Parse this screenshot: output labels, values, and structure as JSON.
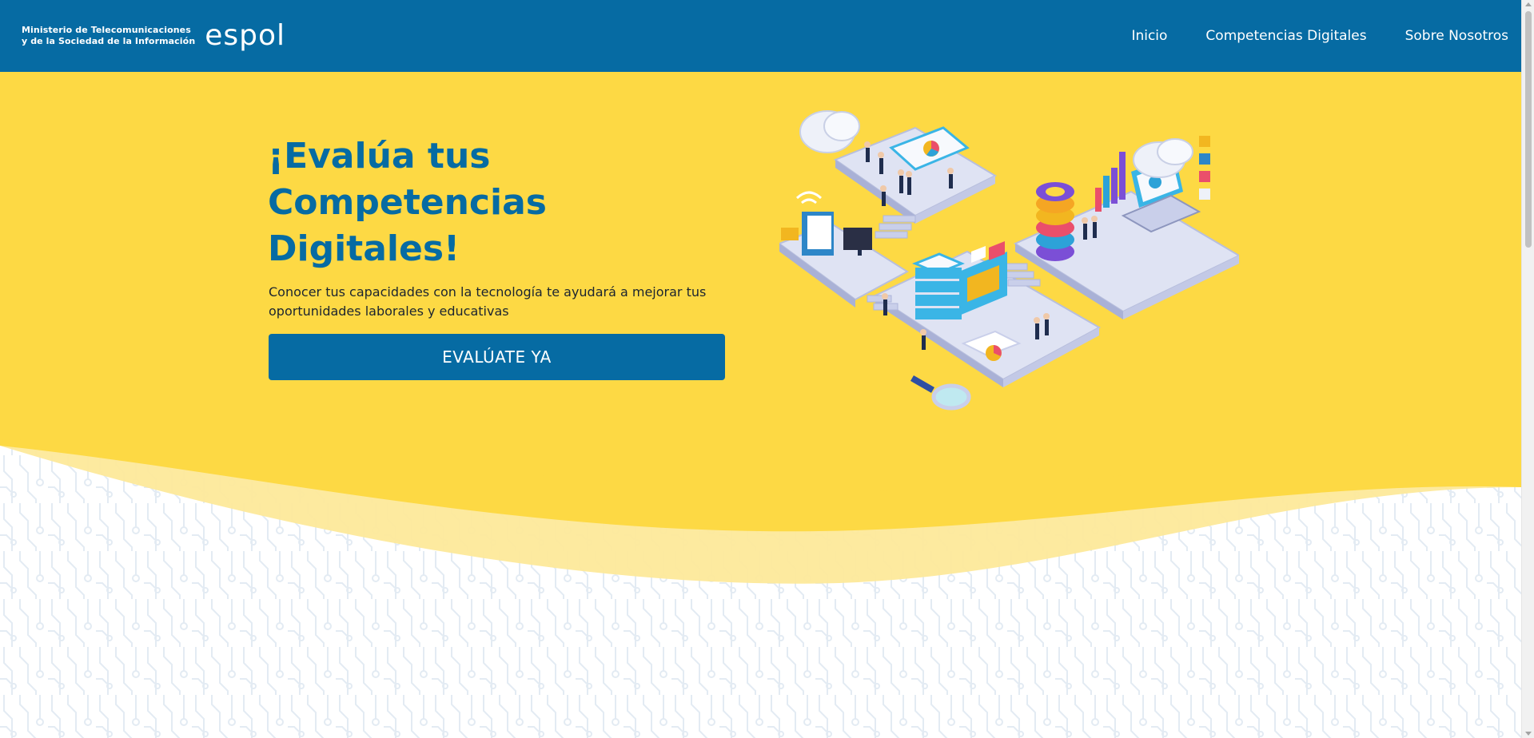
{
  "header": {
    "ministry_line1": "Ministerio de Telecomunicaciones",
    "ministry_line2": "y de la Sociedad de la Información",
    "espol_logo": "espol",
    "nav": [
      {
        "label": "Inicio"
      },
      {
        "label": "Competencias Digitales"
      },
      {
        "label": "Sobre Nosotros"
      }
    ]
  },
  "hero": {
    "title_lines": [
      "¡Evalúa tus",
      "Competencias",
      "Digitales!"
    ],
    "description": "Conocer tus capacidades con la tecnología te ayudará a mejorar tus oportunidades laborales y educativas",
    "cta_label": "EVALÚATE YA",
    "illustration_icon": "isometric-digital-skills-illustration"
  },
  "colors": {
    "primary_blue": "#066ba3",
    "hero_yellow": "#fdd944",
    "wave_light_yellow": "#fde99a",
    "circuit_pattern": "#e3ebf3"
  }
}
